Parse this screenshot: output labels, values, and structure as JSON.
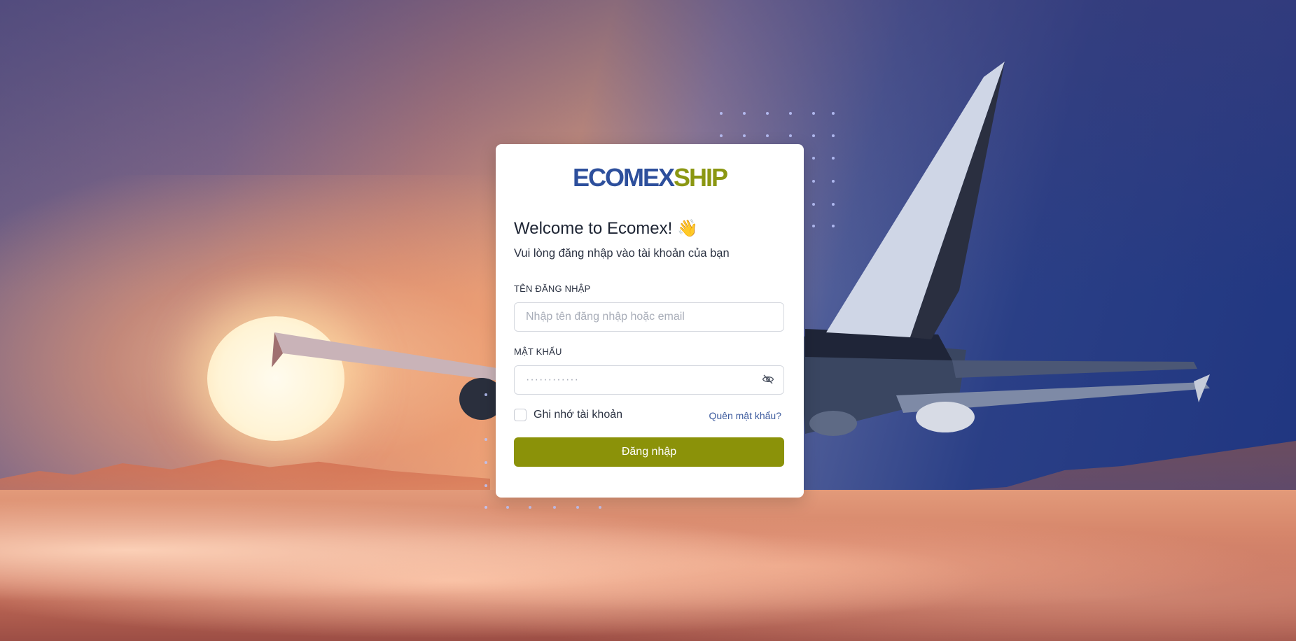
{
  "brand": {
    "logo_part1": "ECOMEX",
    "logo_part2": "SHIP",
    "color_primary": "#2d4f9c",
    "color_accent": "#8b9712"
  },
  "login": {
    "title": "Welcome to Ecomex! 👋",
    "subtitle": "Vui lòng đăng nhập vào tài khoản của bạn",
    "username": {
      "label": "TÊN ĐĂNG NHẬP",
      "placeholder": "Nhập tên đăng nhập hoặc email",
      "value": ""
    },
    "password": {
      "label": "MẬT KHẨU",
      "placeholder": "············",
      "value": "",
      "toggle_icon": "eye-off-icon"
    },
    "remember_label": "Ghi nhớ tài khoản",
    "forgot_label": "Quên mật khẩu?",
    "submit_label": "Đăng nhập",
    "submit_color": "#8b9209"
  }
}
